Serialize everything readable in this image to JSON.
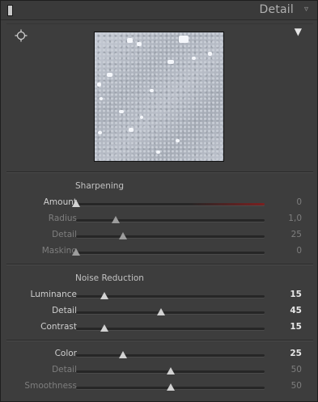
{
  "header": {
    "title": "Detail",
    "collapse_icon": "triangle-down-icon"
  },
  "preview": {
    "target_icon": "crosshair-icon",
    "menu_icon": "triangle-down-icon"
  },
  "sharpening": {
    "title": "Sharpening",
    "rows": [
      {
        "label": "Amount",
        "value": "0",
        "fraction": 0.0
      },
      {
        "label": "Radius",
        "value": "1,0",
        "fraction": 0.21
      },
      {
        "label": "Detail",
        "value": "25",
        "fraction": 0.25
      },
      {
        "label": "Masking",
        "value": "0",
        "fraction": 0.0
      }
    ]
  },
  "noise_reduction": {
    "title": "Noise Reduction",
    "rows": [
      {
        "label": "Luminance",
        "value": "15",
        "fraction": 0.15
      },
      {
        "label": "Detail",
        "value": "45",
        "fraction": 0.45
      },
      {
        "label": "Contrast",
        "value": "15",
        "fraction": 0.15
      }
    ],
    "color_rows": [
      {
        "label": "Color",
        "value": "25",
        "fraction": 0.25
      },
      {
        "label": "Detail",
        "value": "50",
        "fraction": 0.5
      },
      {
        "label": "Smoothness",
        "value": "50",
        "fraction": 0.5
      }
    ]
  },
  "colors": {
    "panel_bg": "#3d3d3d",
    "amount_track_accent": "#7a2020"
  }
}
